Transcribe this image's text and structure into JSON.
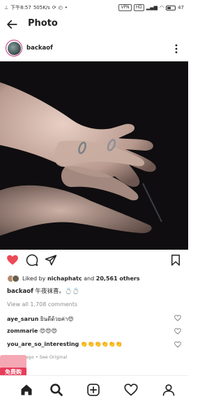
{
  "status_bar": {
    "time": "下午8:57",
    "speed": "505K/s",
    "vpn": "VPN",
    "hd": "HD",
    "battery": "47"
  },
  "header": {
    "title": "Photo"
  },
  "post": {
    "username": "backaof",
    "liked_by_prefix": "Liked by",
    "liked_by_user": "nichaphatc",
    "liked_by_and": "and",
    "likes_count": "20,561 others",
    "caption_user": "backaof",
    "caption_text": "午夜袜喜。💍💍",
    "view_all": "View all 1,708 comments",
    "comments": [
      {
        "user": "aye_sarun",
        "text": "ยินดีด้วยค่า😍"
      },
      {
        "user": "zommarie",
        "text": "😍😍😍"
      },
      {
        "user": "you_are_so_interesting",
        "text": "👏👏👏👏👏👏"
      }
    ],
    "time_ago": "7 hours ago",
    "see_original": "See Original"
  },
  "promo": {
    "label": "免费购"
  },
  "colors": {
    "like_red": "#ed4956",
    "accent": "#c13584",
    "promo_red": "#e83d5a"
  }
}
